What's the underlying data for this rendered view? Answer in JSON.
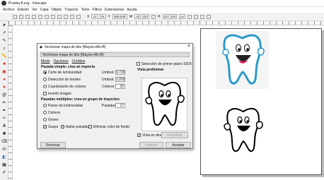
{
  "window": {
    "title": "Prueba 8.svg - Inkscape"
  },
  "menu": [
    "Archivo",
    "Edición",
    "Ver",
    "Capa",
    "Objeto",
    "Trayecto",
    "Texto",
    "Filtros",
    "Extensiones",
    "Ayuda"
  ],
  "toolbar": {
    "x_label": "X",
    "x_value": "117,716",
    "y_label": "Y",
    "y_value": "598,548",
    "w_label": "W",
    "w_value": "427,220",
    "h_label": "H",
    "h_value": "427,220",
    "unit": "px"
  },
  "dialog": {
    "title": "Vectorizar mapa de bits (Mayús+Alt+B)",
    "panel_title": "Vectorizar mapa de bits (Mayús+Alt+B)",
    "tabs": [
      "Modo",
      "Opciones",
      "Créditos"
    ],
    "single_scan": {
      "heading": "Pasada simple: crea un trayecto",
      "options": [
        {
          "label": "Corte de luminosidad",
          "selected": true,
          "param": "Umbral:",
          "value": "0,720"
        },
        {
          "label": "Detección de bordes",
          "selected": false,
          "param": "Umbral:",
          "value": "1,000"
        },
        {
          "label": "Cuantización de colores",
          "selected": false,
          "param": "Colores:",
          "value": "32"
        }
      ],
      "invert_label": "Invertir imagen"
    },
    "multi_scan": {
      "heading": "Pasadas múltiples: crea un grupo de trayectos",
      "options": [
        {
          "label": "Pasos de luminosidad",
          "param": "Pasadas:",
          "value": "17"
        },
        {
          "label": "Colores"
        },
        {
          "label": "Grises"
        }
      ],
      "smooth_label": "Suaya",
      "stack_label": "Apilar pasadas",
      "remove_bg_label": "Eliminar color de fondo"
    },
    "right": {
      "sioxs_label": "Selección de primer plano SIOX",
      "preview_heading": "Vista preliminar",
      "live_preview_label": "Vista en directo",
      "update_label": "Actualizar"
    },
    "buttons": {
      "reset": "Reiniciar",
      "stop": "Detener",
      "ok": "Aceptar"
    }
  },
  "colors": {
    "tooth_outline": "#2a9ac9",
    "tongue": "#e3155e"
  }
}
